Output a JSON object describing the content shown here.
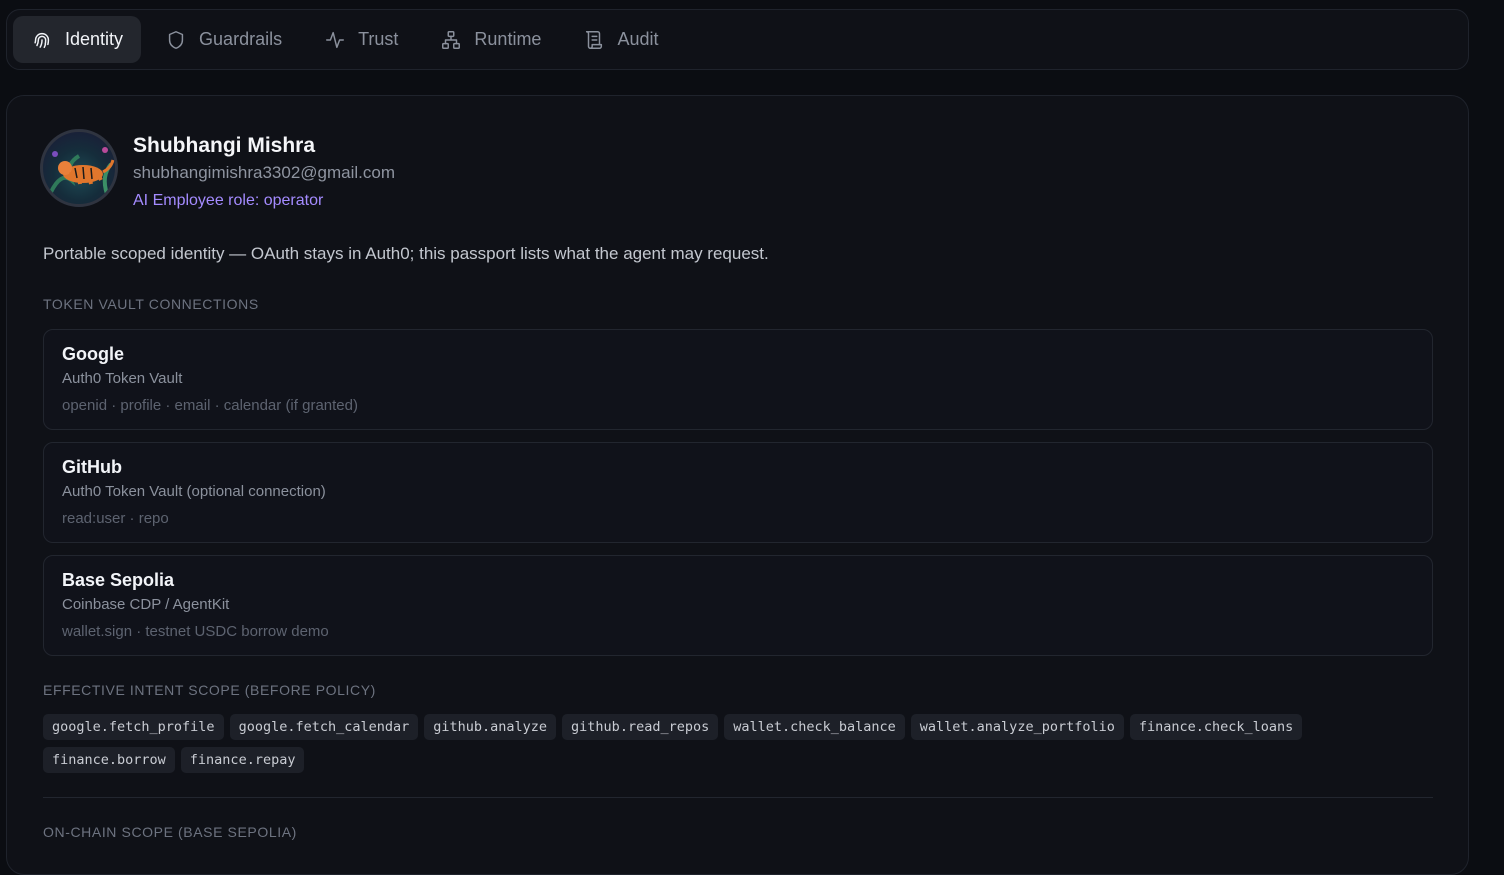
{
  "tabs": [
    {
      "label": "Identity",
      "icon": "fingerprint-icon",
      "active": true
    },
    {
      "label": "Guardrails",
      "icon": "shield-icon",
      "active": false
    },
    {
      "label": "Trust",
      "icon": "activity-icon",
      "active": false
    },
    {
      "label": "Runtime",
      "icon": "network-icon",
      "active": false
    },
    {
      "label": "Audit",
      "icon": "scroll-icon",
      "active": false
    }
  ],
  "profile": {
    "name": "Shubhangi Mishra",
    "email": "shubhangimishra3302@gmail.com",
    "role": "AI Employee role: operator"
  },
  "description": "Portable scoped identity — OAuth stays in Auth0; this passport lists what the agent may request.",
  "sections": {
    "token_vault": "TOKEN VAULT CONNECTIONS",
    "intent_scope": "EFFECTIVE INTENT SCOPE (BEFORE POLICY)",
    "onchain_scope": "ON-CHAIN SCOPE (BASE SEPOLIA)"
  },
  "connections": [
    {
      "name": "Google",
      "provider": "Auth0 Token Vault",
      "scopes": "openid · profile · email · calendar (if granted)"
    },
    {
      "name": "GitHub",
      "provider": "Auth0 Token Vault (optional connection)",
      "scopes": "read:user · repo"
    },
    {
      "name": "Base Sepolia",
      "provider": "Coinbase CDP / AgentKit",
      "scopes": "wallet.sign · testnet USDC borrow demo"
    }
  ],
  "intent_scopes": [
    "google.fetch_profile",
    "google.fetch_calendar",
    "github.analyze",
    "github.read_repos",
    "wallet.check_balance",
    "wallet.analyze_portfolio",
    "finance.check_loans",
    "finance.borrow",
    "finance.repay"
  ],
  "colors": {
    "accent": "#a48bff",
    "background": "#0b0d12",
    "panel": "#0f1117"
  }
}
